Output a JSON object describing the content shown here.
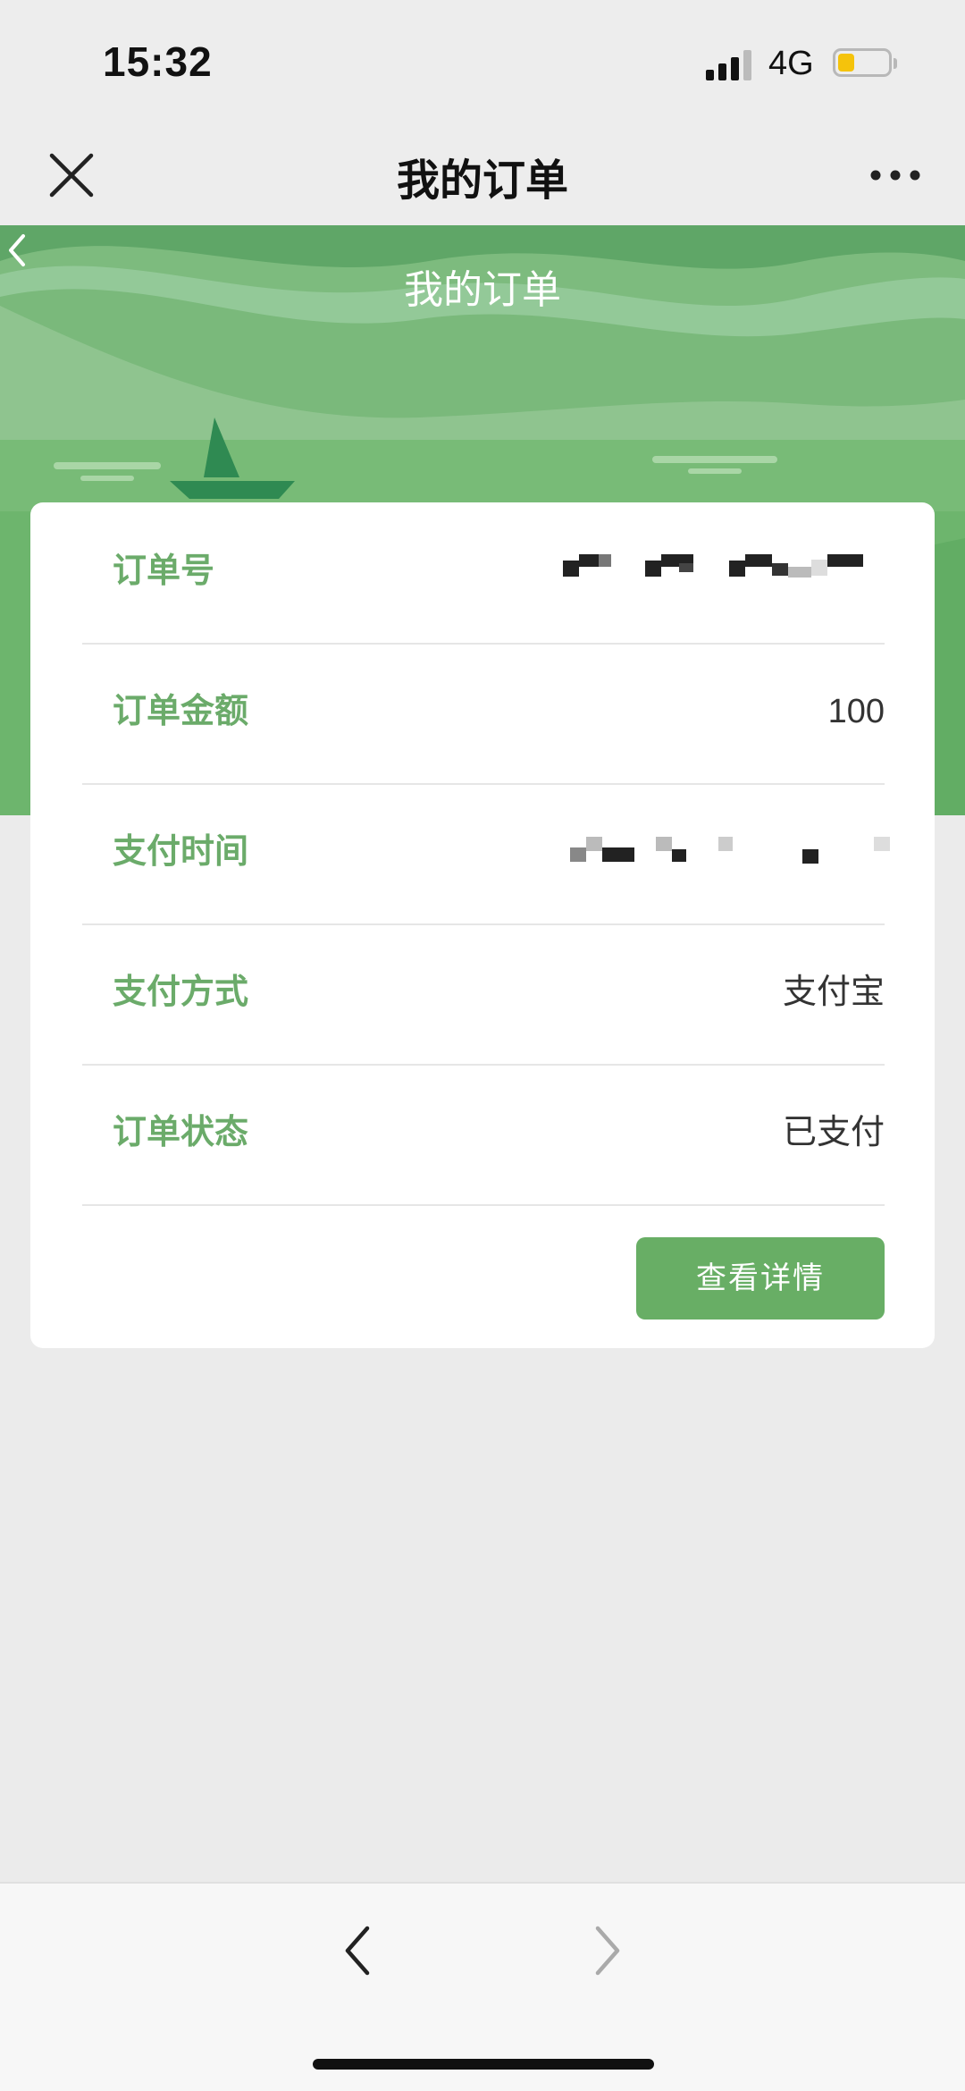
{
  "status_bar": {
    "time": "15:32",
    "network": "4G"
  },
  "nav": {
    "title": "我的订单"
  },
  "banner": {
    "title": "我的订单"
  },
  "order": {
    "rows": [
      {
        "label": "订单号",
        "value": null
      },
      {
        "label": "订单金额",
        "value": "100"
      },
      {
        "label": "支付时间",
        "value": null
      },
      {
        "label": "支付方式",
        "value": "支付宝"
      },
      {
        "label": "订单状态",
        "value": "已支付"
      }
    ],
    "detail_button": "查看详情"
  },
  "colors": {
    "accent": "#68ae65",
    "label_green": "#6bab6a",
    "background": "#ebebeb"
  },
  "icons": [
    "close-icon",
    "more-icon",
    "chevron-left-icon",
    "chevron-right-icon"
  ]
}
